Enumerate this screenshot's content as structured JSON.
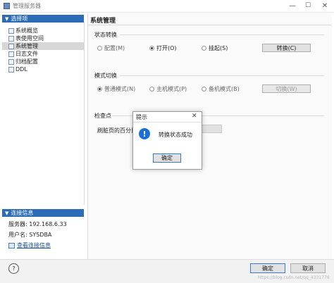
{
  "window": {
    "title": "管理服务器",
    "minimize_symbol": "—",
    "maximize_symbol": "☐",
    "close_symbol": "✕"
  },
  "left": {
    "options_header": "选择项",
    "nav_items": [
      {
        "label": "系统概览"
      },
      {
        "label": "表使用空间"
      },
      {
        "label": "系统管理"
      },
      {
        "label": "日志文件"
      },
      {
        "label": "归档配置"
      },
      {
        "label": "DDL"
      }
    ],
    "connection_header": "连接信息",
    "server_line": "服务器: 192.168.6.33",
    "user_line": "用户名: SYSDBA",
    "view_conn_link": "查看连接信息"
  },
  "main": {
    "title": "系统管理",
    "state_group": {
      "label": "状态转换",
      "options": [
        {
          "label": "配置(M)"
        },
        {
          "label": "打开(O)"
        },
        {
          "label": "挂起(S)"
        }
      ],
      "button": "转换(C)"
    },
    "mode_group": {
      "label": "模式切换",
      "options": [
        {
          "label": "普通模式(N)"
        },
        {
          "label": "主机模式(P)"
        },
        {
          "label": "备机模式(B)"
        }
      ],
      "button": "切换(W)"
    },
    "checkpoint": {
      "label": "检查点",
      "field_label": "刷脏页的百分比("
    }
  },
  "dialog": {
    "title": "提示",
    "close_symbol": "✕",
    "icon_glyph": "!",
    "message": "转换状态成功",
    "ok_button": "确定"
  },
  "footer": {
    "help_symbol": "?",
    "ok_button": "确定",
    "cancel_button": "取消",
    "watermark": "https://blog.csdn.net/qq_4331776"
  },
  "colors": {
    "accent_header": "#2c6bb6",
    "info_icon": "#1b6fd8"
  }
}
